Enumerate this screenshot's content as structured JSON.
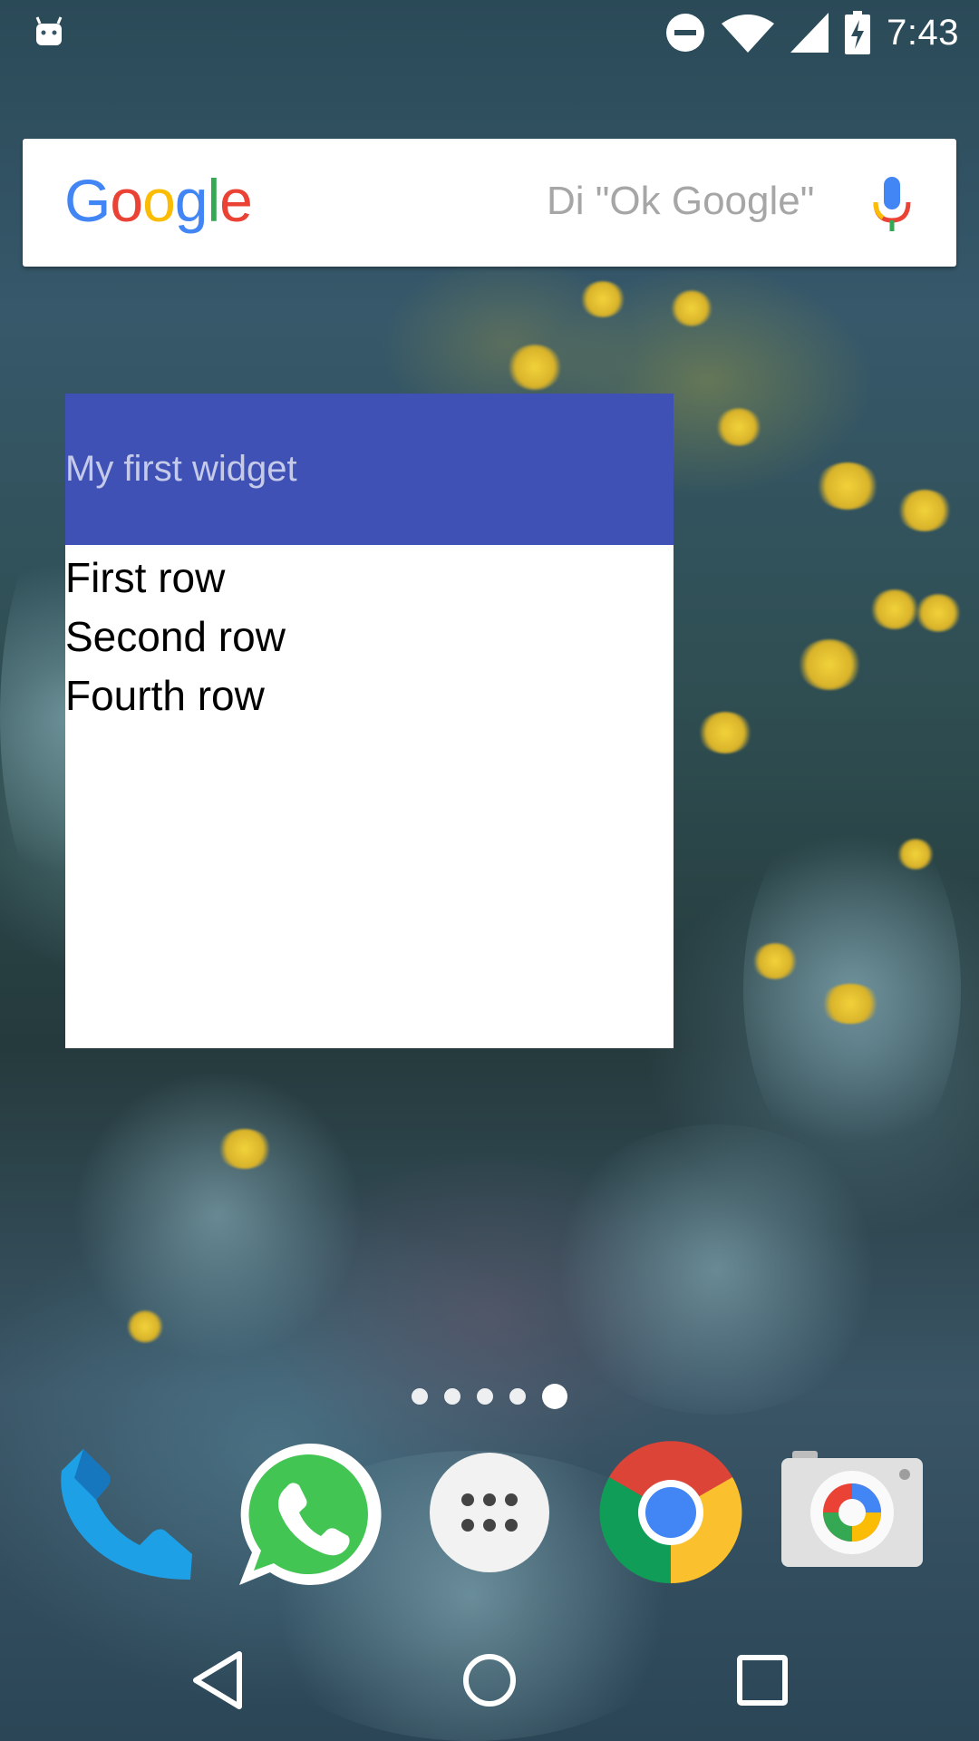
{
  "status_bar": {
    "time": "7:43",
    "icons": [
      "android-debug-icon",
      "do-not-disturb-icon",
      "wifi-icon",
      "cell-signal-icon",
      "battery-charging-icon"
    ]
  },
  "search": {
    "logo_letters": [
      {
        "char": "G",
        "color": "#4285F4"
      },
      {
        "char": "o",
        "color": "#EA4335"
      },
      {
        "char": "o",
        "color": "#FBBC05"
      },
      {
        "char": "g",
        "color": "#4285F4"
      },
      {
        "char": "l",
        "color": "#34A853"
      },
      {
        "char": "e",
        "color": "#EA4335"
      }
    ],
    "hint": "Di \"Ok Google\""
  },
  "widget": {
    "title": "My first widget",
    "header_color": "#3f51b5",
    "rows": [
      "First row",
      "Second row",
      "Fourth row"
    ]
  },
  "home": {
    "page_count": 5,
    "active_page": 5,
    "dock_apps": [
      "phone-icon",
      "whatsapp-icon",
      "app-drawer-icon",
      "chrome-icon",
      "camera-icon"
    ]
  },
  "nav_bar": {
    "buttons": [
      "back-icon",
      "home-icon",
      "recents-icon"
    ]
  }
}
